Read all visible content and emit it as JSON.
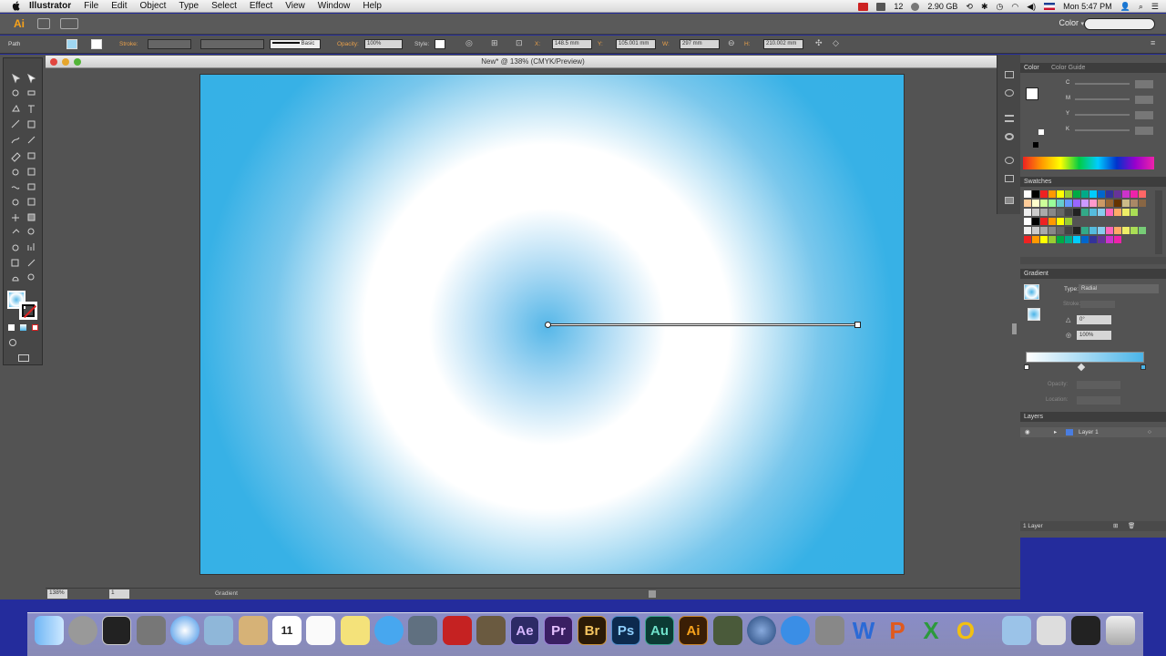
{
  "menubar": {
    "app_name": "Illustrator",
    "items": [
      "File",
      "Edit",
      "Object",
      "Type",
      "Select",
      "Effect",
      "View",
      "Window",
      "Help"
    ],
    "status_text": "12",
    "memory": "2.90 GB",
    "clock": "Mon 5:47 PM"
  },
  "appbar": {
    "logo": "Ai",
    "workspace": "Color"
  },
  "controlbar": {
    "selection": "Path",
    "stroke_label": "Stroke:",
    "brush": "Basic",
    "opacity_label": "Opacity:",
    "opacity": "100%",
    "style_label": "Style:",
    "x_label": "X:",
    "x": "148.5 mm",
    "y_label": "Y:",
    "y": "105.001 mm",
    "w_label": "W:",
    "w": "297 mm",
    "h_label": "H:",
    "h": "210.002 mm"
  },
  "document": {
    "title": "New* @ 138% (CMYK/Preview)",
    "zoom": "138%",
    "artboard_num": "1",
    "status_tool": "Gradient"
  },
  "color_panel": {
    "tab_color": "Color",
    "tab_guide": "Color Guide",
    "channels": [
      "C",
      "M",
      "Y",
      "K"
    ]
  },
  "swatches_panel": {
    "title": "Swatches"
  },
  "gradient_panel": {
    "title": "Gradient",
    "type_label": "Type:",
    "type_value": "Radial",
    "stroke_label": "Stroke:",
    "angle": "0°",
    "aspect": "100%",
    "opacity_label": "Opacity:",
    "location_label": "Location:"
  },
  "layers_panel": {
    "title": "Layers",
    "layer_name": "Layer 1",
    "footer": "1 Layer"
  },
  "dock": {
    "apps": [
      "Ae",
      "Pr",
      "Br",
      "Ps",
      "Au",
      "Ai"
    ],
    "calendar_day": "11",
    "colors": {
      "ae": "#2d2a66",
      "pr": "#3a1f63",
      "br": "#2b1a06",
      "ps": "#0c2a4e",
      "au": "#0c3b34",
      "ai": "#3a1e05"
    }
  }
}
